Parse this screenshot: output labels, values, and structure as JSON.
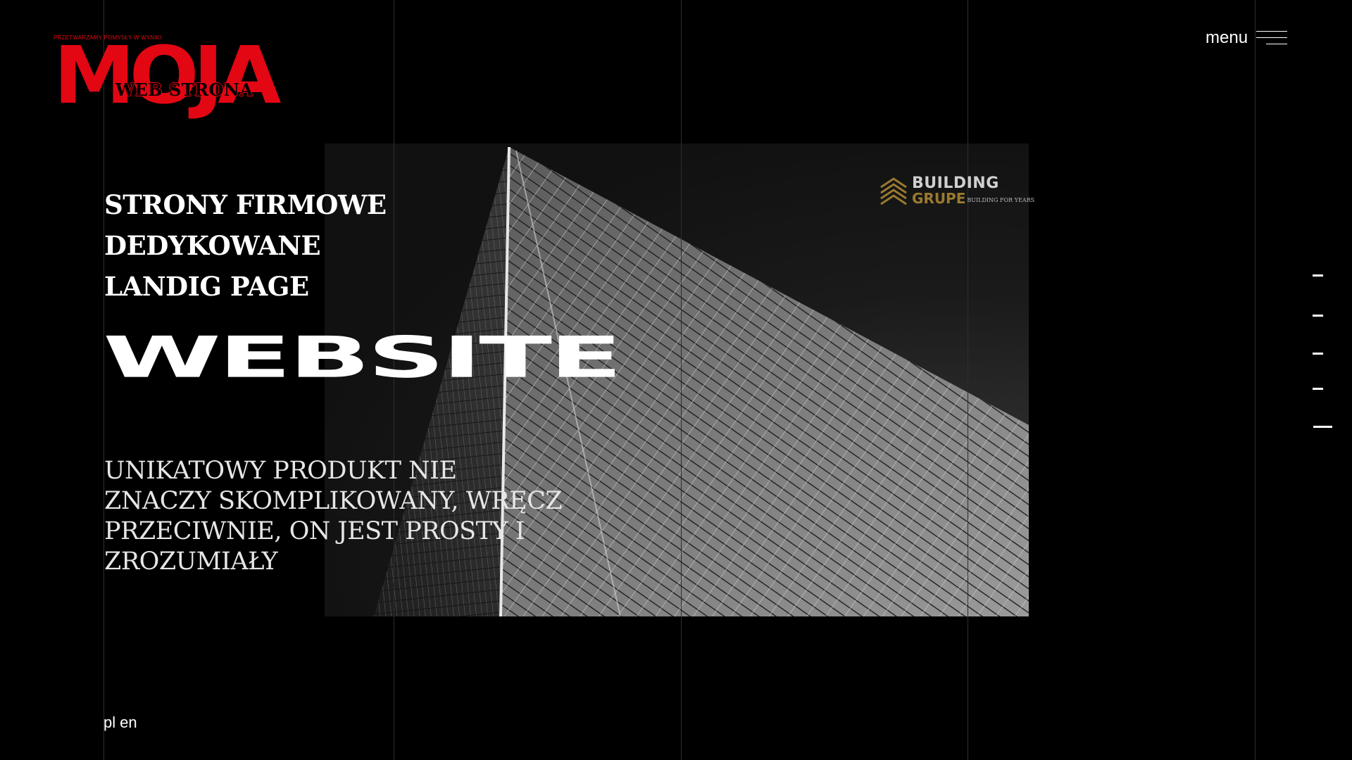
{
  "brand": {
    "tagline": "PRZETWARZAMY POMYSŁY W WYNIKI",
    "wordmark": "MOJA",
    "subtitle": "WEB STRONA",
    "color": "#e30613"
  },
  "menu": {
    "label": "menu",
    "icon": "hamburger-icon"
  },
  "hero": {
    "services": [
      "STRONY FIRMOWE",
      "DEDYKOWANE",
      "LANDIG PAGE"
    ],
    "title": "WEBSITE",
    "tagline": "UNIKATOWY PRODUKT NIE ZNACZY SKOMPLIKOWANY, WRĘCZ PRZECIWNIE, ON JEST PROSTY I ZROZUMIAŁY",
    "image_logo": {
      "line1": "BUILDING",
      "line2": "GRUPE",
      "slogan": "BUILDING FOR YEARS",
      "accent": "#9a7a2f"
    }
  },
  "languages": [
    "pl",
    "en"
  ],
  "slider": {
    "count": 5,
    "active_index": 4
  }
}
